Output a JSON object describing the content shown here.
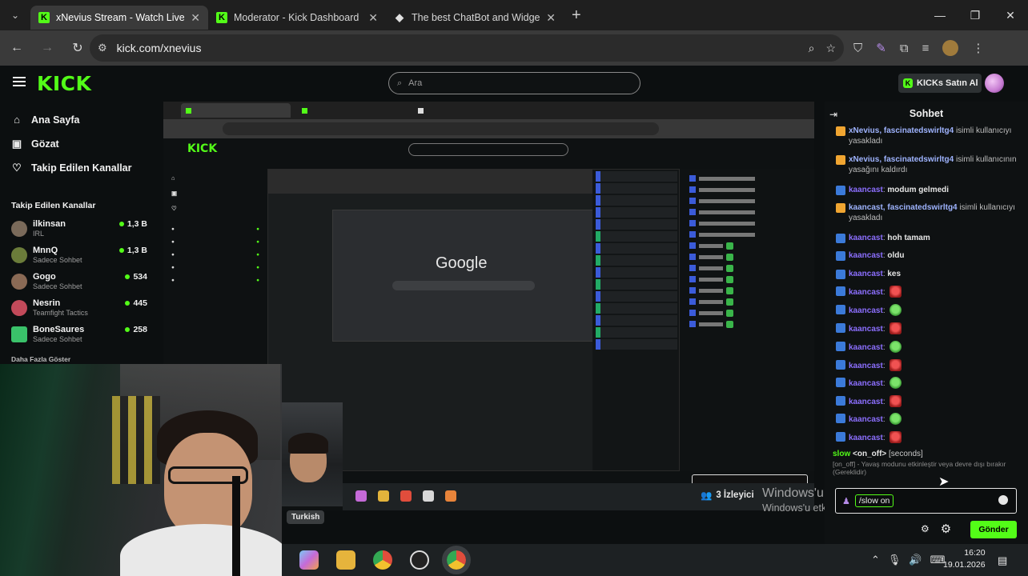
{
  "browser": {
    "tabs": [
      {
        "title": "xNevius Stream - Watch Live on",
        "active": true,
        "favicon": "kick-icon"
      },
      {
        "title": "Moderator - Kick Dashboard",
        "active": false,
        "favicon": "kick-icon"
      },
      {
        "title": "The best ChatBot and Widgets",
        "active": false,
        "favicon": "botrix-icon"
      }
    ],
    "url": "kick.com/xnevius"
  },
  "kick": {
    "logo": "KICK",
    "search_placeholder": "Ara",
    "buy_button": "KICKs Satın Al",
    "nav": [
      "Ana Sayfa",
      "Gözat",
      "Takip Edilen Kanallar"
    ],
    "followed_header": "Takip Edilen Kanallar",
    "channels": [
      {
        "name": "ilkinsan",
        "category": "IRL",
        "viewers": "1,3 B",
        "color": "#7a6a5a"
      },
      {
        "name": "MnnQ",
        "category": "Sadece Sohbet",
        "viewers": "1,3 B",
        "color": "#6b7c3a"
      },
      {
        "name": "Gogo",
        "category": "Sadece Sohbet",
        "viewers": "534",
        "color": "#8a6a55"
      },
      {
        "name": "Nesrin",
        "category": "Teamfight Tactics",
        "viewers": "445",
        "color": "#c24a5a"
      },
      {
        "name": "BoneSaures",
        "category": "Sadece Sohbet",
        "viewers": "258",
        "color": "#3ac26a"
      }
    ],
    "show_more": "Daha Fazla Göster"
  },
  "stream": {
    "viewers": "3 İzleyici",
    "language": "Turkish",
    "activate_line1": "Windows'u Etkinleştirin",
    "activate_line2": "Windows'u etkinleştirmek için Ayarlar'a gidin.",
    "clock_time": "16:20",
    "clock_date": "19.01.2026"
  },
  "chat": {
    "title": "Sohbet",
    "messages": [
      {
        "user": "xNevius, fascinatedswirltg4",
        "text": "isimli kullanıcıyı yasakladı",
        "kind": "mod"
      },
      {
        "user": "xNevius, fascinatedswirltg4",
        "text": "isimli kullanıcının yasağını kaldırdı",
        "kind": "mod"
      },
      {
        "user": "kaancast",
        "text": "modum gelmedi",
        "kind": "bot"
      },
      {
        "user": "kaancast, fascinatedswirltg4",
        "text": "isimli kullanıcıyı yasakladı",
        "kind": "mod"
      },
      {
        "user": "kaancast",
        "text": "hoh tamam",
        "kind": "bot"
      },
      {
        "user": "kaancast",
        "text": "oldu",
        "kind": "bot"
      },
      {
        "user": "kaancast",
        "text": "kes",
        "kind": "bot"
      },
      {
        "user": "kaancast",
        "text": "",
        "emote": "red"
      },
      {
        "user": "kaancast",
        "text": "",
        "emote": "grn"
      },
      {
        "user": "kaancast",
        "text": "",
        "emote": "red"
      },
      {
        "user": "kaancast",
        "text": "",
        "emote": "grn"
      },
      {
        "user": "kaancast",
        "text": "",
        "emote": "red"
      },
      {
        "user": "kaancast",
        "text": "",
        "emote": "grn"
      },
      {
        "user": "kaancast",
        "text": "",
        "emote": "red"
      },
      {
        "user": "kaancast",
        "text": "",
        "emote": "grn"
      },
      {
        "user": "kaancast",
        "text": "",
        "emote": "red"
      }
    ],
    "command_name": "slow",
    "command_args": "<on_off>",
    "command_opt": "[seconds]",
    "command_desc": "[on_off] - Yavaş modunu etkinleştir veya devre dışı bırakır (Gereklidir)",
    "input_value": "/slow on",
    "send_label": "Gönder"
  },
  "colors": {
    "accent": "#53fc18",
    "username": "#8c6fff"
  }
}
